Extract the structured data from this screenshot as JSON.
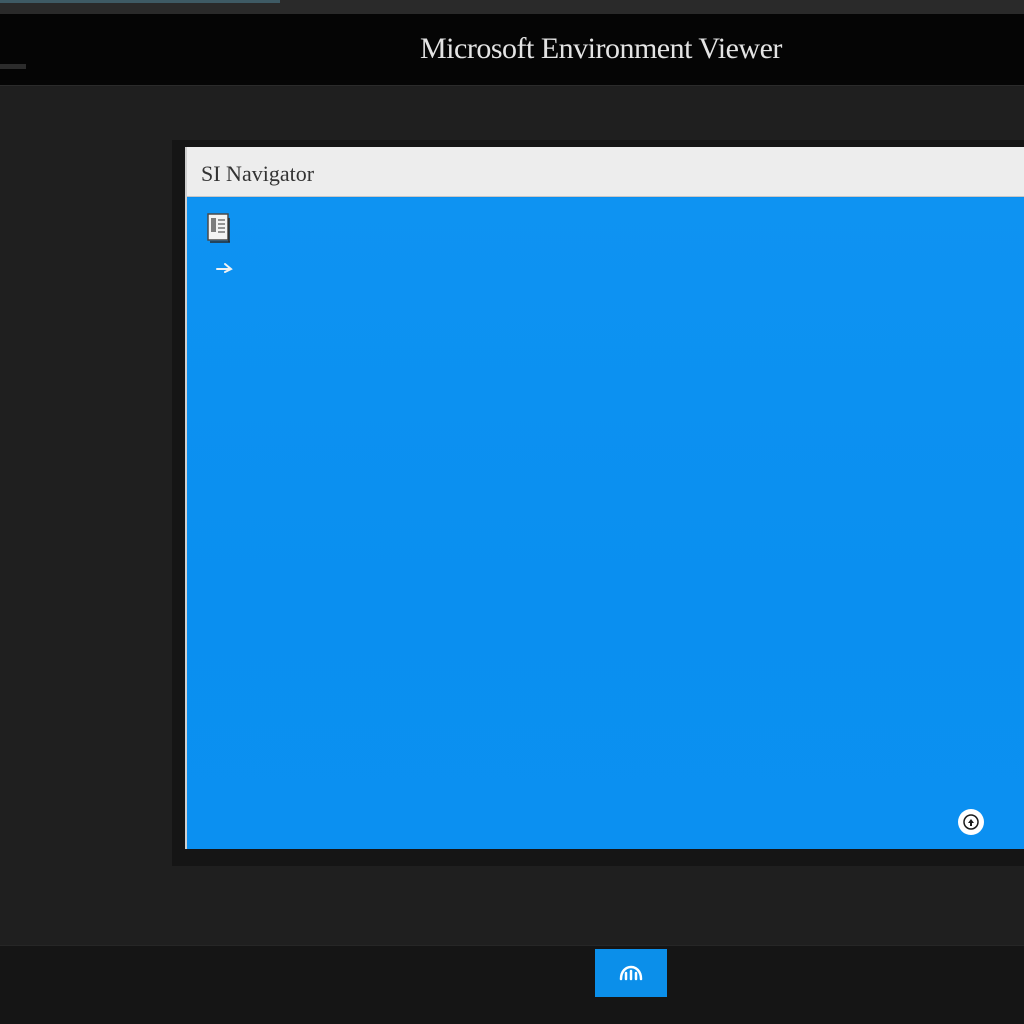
{
  "app": {
    "title": "Microsoft Environment Viewer"
  },
  "window": {
    "title": "SI Navigator"
  },
  "icons": {
    "menu": "menu-dash-icon",
    "document": "document-icon",
    "arrow": "arrow-icon",
    "info": "info-icon",
    "taskbar_app": "taskbar-app-icon"
  },
  "colors": {
    "accent_blue": "#0a8ff0",
    "title_bar": "#050505",
    "window_header": "#ededed",
    "background": "#1f1f1f",
    "taskbar": "#151515"
  }
}
